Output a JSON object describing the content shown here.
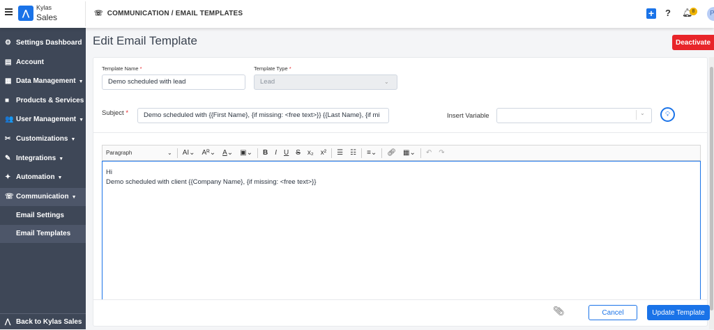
{
  "header": {
    "brand_top": "Kylas",
    "brand_bottom": "Sales",
    "breadcrumb": "COMMUNICATION / EMAIL TEMPLATES",
    "notification_count": "8",
    "avatar_initial": "P",
    "help": "?"
  },
  "sidebar": {
    "items": [
      {
        "label": "Settings Dashboard",
        "icon": "⚙"
      },
      {
        "label": "Account",
        "icon": "▤"
      },
      {
        "label": "Data Management",
        "icon": "▦",
        "caret": "▼"
      },
      {
        "label": "Products & Services",
        "icon": "■"
      },
      {
        "label": "User Management",
        "icon": "👥",
        "caret": "▼"
      },
      {
        "label": "Customizations",
        "icon": "✂",
        "caret": "▼"
      },
      {
        "label": "Integrations",
        "icon": "✎",
        "caret": "▼"
      },
      {
        "label": "Automation",
        "icon": "✦",
        "caret": "▼"
      },
      {
        "label": "Communication",
        "icon": "☏",
        "caret": "▼"
      }
    ],
    "sub_items": [
      {
        "label": "Email Settings"
      },
      {
        "label": "Email Templates"
      }
    ],
    "back": "Back to Kylas Sales"
  },
  "page": {
    "title": "Edit Email Template",
    "deactivate": "Deactivate"
  },
  "form": {
    "template_name_label": "Template Name",
    "template_name": "Demo scheduled with lead",
    "template_type_label": "Template Type",
    "template_type": "Lead",
    "subject_label": "Subject",
    "subject": "Demo scheduled with  {{First Name}, {if missing: <free text>}}  {{Last Name}, {if mi",
    "insert_variable_label": "Insert Variable",
    "insert_variable": "",
    "required": "*"
  },
  "toolbar": {
    "paragraph": "Paragraph"
  },
  "editor": {
    "line1": "Hi",
    "line2": "Demo scheduled with client  {{Company Name}, {if missing: <free text>}}"
  },
  "footer": {
    "cancel": "Cancel",
    "update": "Update Template"
  },
  "colors": {
    "primary": "#1a73e8",
    "danger": "#e8252a",
    "sidebar": "#3e4757"
  }
}
